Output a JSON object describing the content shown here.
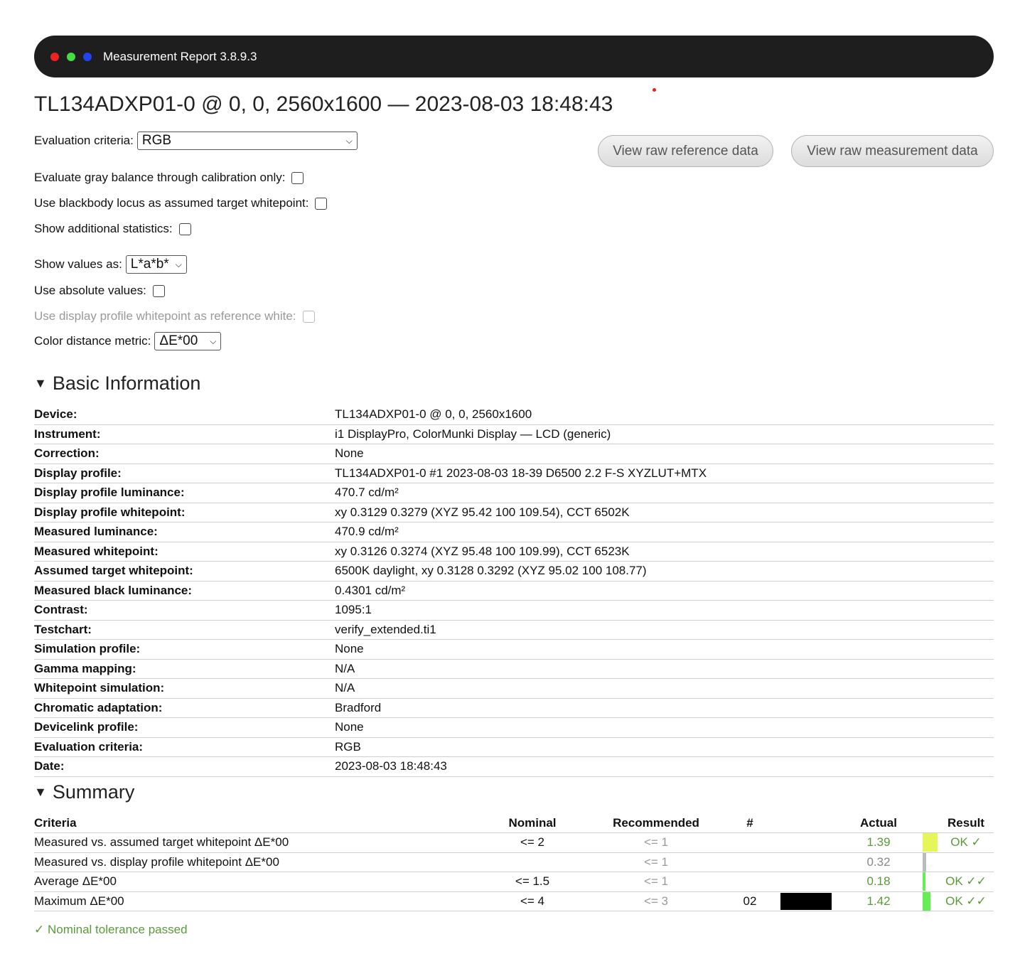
{
  "window": {
    "title": "Measurement Report 3.8.9.3",
    "dots": [
      "#ee2222",
      "#44dd44",
      "#2244ee"
    ]
  },
  "page_title": "TL134ADXP01-0 @ 0, 0, 2560x1600 — 2023-08-03 18:48:43",
  "controls": {
    "evaluation_criteria_label": "Evaluation criteria:",
    "evaluation_criteria_value": "RGB",
    "gray_balance_label": "Evaluate gray balance through calibration only:",
    "blackbody_label": "Use blackbody locus as assumed target whitepoint:",
    "additional_stats_label": "Show additional statistics:",
    "show_values_label": "Show values as:",
    "show_values_value": "L*a*b*",
    "absolute_values_label": "Use absolute values:",
    "display_profile_wp_label": "Use display profile whitepoint as reference white:",
    "distance_metric_label": "Color distance metric:",
    "distance_metric_value": "ΔE*00",
    "view_raw_reference": "View raw reference data",
    "view_raw_measurement": "View raw measurement data"
  },
  "basic_info": {
    "heading": "Basic Information",
    "toggle": "▼",
    "rows": [
      {
        "label": "Device:",
        "value": "TL134ADXP01-0 @ 0, 0, 2560x1600"
      },
      {
        "label": "Instrument:",
        "value": "i1 DisplayPro, ColorMunki Display — LCD (generic)"
      },
      {
        "label": "Correction:",
        "value": "None"
      },
      {
        "label": "Display profile:",
        "value": "TL134ADXP01-0 #1 2023-08-03 18-39 D6500 2.2 F-S XYZLUT+MTX"
      },
      {
        "label": "Display profile luminance:",
        "value": "470.7 cd/m²"
      },
      {
        "label": "Display profile whitepoint:",
        "value": "xy 0.3129 0.3279 (XYZ 95.42 100 109.54), CCT 6502K"
      },
      {
        "label": "Measured luminance:",
        "value": "470.9 cd/m²"
      },
      {
        "label": "Measured whitepoint:",
        "value": "xy 0.3126 0.3274 (XYZ 95.48 100 109.99), CCT 6523K"
      },
      {
        "label": "Assumed target whitepoint:",
        "value": "6500K daylight, xy 0.3128 0.3292 (XYZ 95.02 100 108.77)"
      },
      {
        "label": "Measured black luminance:",
        "value": "0.4301 cd/m²"
      },
      {
        "label": "Contrast:",
        "value": "1095:1"
      },
      {
        "label": "Testchart:",
        "value": "verify_extended.ti1"
      },
      {
        "label": "Simulation profile:",
        "value": "None"
      },
      {
        "label": "Gamma mapping:",
        "value": "N/A"
      },
      {
        "label": "Whitepoint simulation:",
        "value": "N/A"
      },
      {
        "label": "Chromatic adaptation:",
        "value": "Bradford"
      },
      {
        "label": "Devicelink profile:",
        "value": "None"
      },
      {
        "label": "Evaluation criteria:",
        "value": "RGB"
      },
      {
        "label": "Date:",
        "value": "2023-08-03 18:48:43"
      }
    ]
  },
  "summary": {
    "heading": "Summary",
    "toggle": "▼",
    "columns": {
      "criteria": "Criteria",
      "nominal": "Nominal",
      "recommended": "Recommended",
      "num": "#",
      "actual": "Actual",
      "result": "Result"
    },
    "rows": [
      {
        "criteria": "Measured vs. assumed target whitepoint ΔE*00",
        "nominal": "<= 2",
        "recommended": "<= 1",
        "num": "",
        "patch": false,
        "actual": "1.39",
        "actual_status": "ok",
        "bar_color": "#e6f55a",
        "bar_fraction": 0.7,
        "result": "OK ✓"
      },
      {
        "criteria": "Measured vs. display profile whitepoint ΔE*00",
        "nominal": "",
        "recommended": "<= 1",
        "num": "",
        "patch": false,
        "actual": "0.32",
        "actual_status": "info",
        "bar_color": "#bbbbbb",
        "bar_fraction": 0.16,
        "result": ""
      },
      {
        "criteria": "Average ΔE*00",
        "nominal": "<= 1.5",
        "recommended": "<= 1",
        "num": "",
        "patch": false,
        "actual": "0.18",
        "actual_status": "ok",
        "bar_color": "#66ee55",
        "bar_fraction": 0.12,
        "result": "OK ✓✓"
      },
      {
        "criteria": "Maximum ΔE*00",
        "nominal": "<= 4",
        "recommended": "<= 3",
        "num": "02",
        "patch": true,
        "patch_color": "#000000",
        "actual": "1.42",
        "actual_status": "ok",
        "bar_color": "#66ee55",
        "bar_fraction": 0.36,
        "result": "OK ✓✓"
      }
    ],
    "footer": "✓ Nominal tolerance passed"
  }
}
